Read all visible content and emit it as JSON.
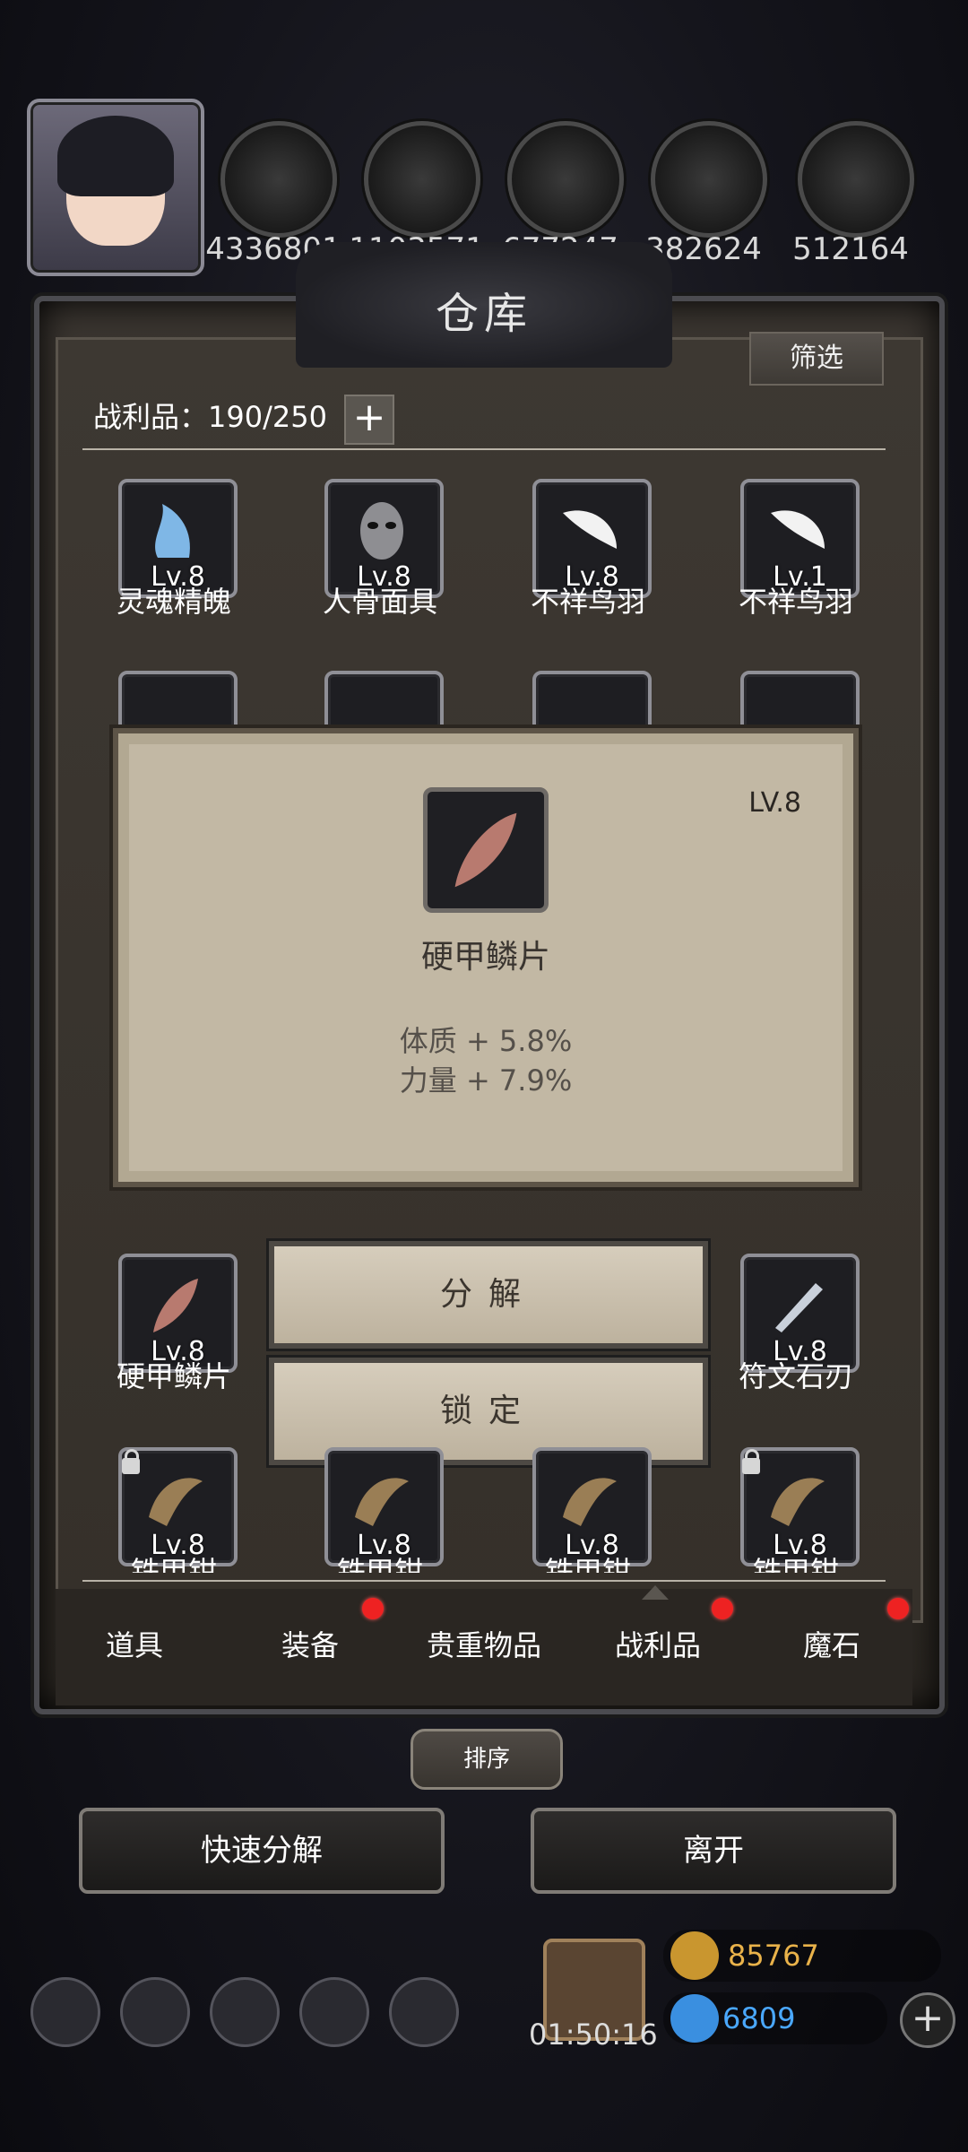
{
  "resources": {
    "values": [
      "4336801",
      "1103571",
      "677247",
      "382624",
      "512164"
    ],
    "icons": [
      "copper-ore-icon",
      "wood-plank-icon",
      "iron-ingot-icon",
      "crystal-icon",
      "stone-block-icon"
    ]
  },
  "warehouse": {
    "title": "仓库",
    "filter_label": "筛选",
    "loot_count_label": "战利品：190/250",
    "plus": "+"
  },
  "grid": {
    "row1": [
      {
        "level": "Lv.8",
        "name": "灵魂精魄",
        "icon": "soul-essence-icon"
      },
      {
        "level": "Lv.8",
        "name": "人骨面具",
        "icon": "bone-mask-icon"
      },
      {
        "level": "Lv.8",
        "name": "不祥鸟羽",
        "icon": "white-feather-icon"
      },
      {
        "level": "Lv.1",
        "name": "不祥鸟羽",
        "icon": "white-feather-icon"
      }
    ],
    "row3_left": {
      "level": "Lv.8",
      "name": "硬甲鳞片",
      "icon": "hard-scale-icon"
    },
    "row3_right": {
      "level": "Lv.8",
      "name": "符文石刃",
      "icon": "rune-blade-icon"
    },
    "row4": [
      {
        "level": "Lv.8",
        "name": "铁甲钳",
        "icon": "claw-icon"
      },
      {
        "level": "Lv.8",
        "name": "铁甲钳",
        "icon": "claw-icon"
      },
      {
        "level": "Lv.8",
        "name": "铁甲钳",
        "icon": "claw-icon"
      },
      {
        "level": "Lv.8",
        "name": "铁甲钳",
        "icon": "claw-icon"
      }
    ]
  },
  "tooltip": {
    "level": "LV.8",
    "name": "硬甲鳞片",
    "stat1": "体质 + 5.8%",
    "stat2": "力量 + 7.9%"
  },
  "actions": {
    "decompose": "分解",
    "lock": "锁定"
  },
  "tabs": [
    {
      "label": "道具",
      "badge": false
    },
    {
      "label": "装备",
      "badge": true
    },
    {
      "label": "贵重物品",
      "badge": false
    },
    {
      "label": "战利品",
      "badge": true,
      "active": true
    },
    {
      "label": "魔石",
      "badge": true
    }
  ],
  "sort_label": "排序",
  "footer": {
    "quick_decompose": "快速分解",
    "leave": "离开"
  },
  "hud": {
    "timer": "01:50:16",
    "gold": "85767",
    "gems": "6809"
  },
  "colors": {
    "accent_red": "#e22222",
    "tooltip_bg": "#c2b8a4",
    "gold_text": "#e9b24a",
    "gem_text": "#4aa8ff"
  }
}
